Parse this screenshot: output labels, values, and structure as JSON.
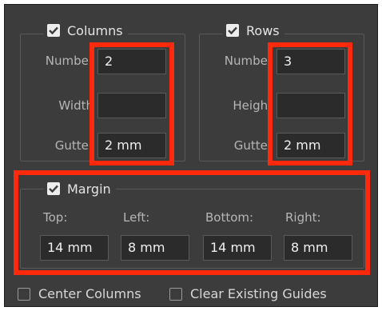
{
  "columns": {
    "title": "Columns",
    "checked": true,
    "number_label": "Number",
    "number_value": "2",
    "width_label": "Width",
    "width_value": "",
    "gutter_label": "Gutter",
    "gutter_value": "2 mm"
  },
  "rows": {
    "title": "Rows",
    "checked": true,
    "number_label": "Number",
    "number_value": "3",
    "height_label": "Height",
    "height_value": "",
    "gutter_label": "Gutter",
    "gutter_value": "2 mm"
  },
  "margin": {
    "title": "Margin",
    "checked": true,
    "top_label": "Top:",
    "left_label": "Left:",
    "bottom_label": "Bottom:",
    "right_label": "Right:",
    "top_value": "14 mm",
    "left_value": "8 mm",
    "bottom_value": "14 mm",
    "right_value": "8 mm"
  },
  "options": {
    "center_columns_label": "Center Columns",
    "center_columns_checked": false,
    "clear_guides_label": "Clear Existing Guides",
    "clear_guides_checked": false
  },
  "colors": {
    "panel_bg": "#3c3c3c",
    "field_bg": "#2b2b2b",
    "highlight": "#ff2a0b",
    "check_bg": "#ededed"
  }
}
